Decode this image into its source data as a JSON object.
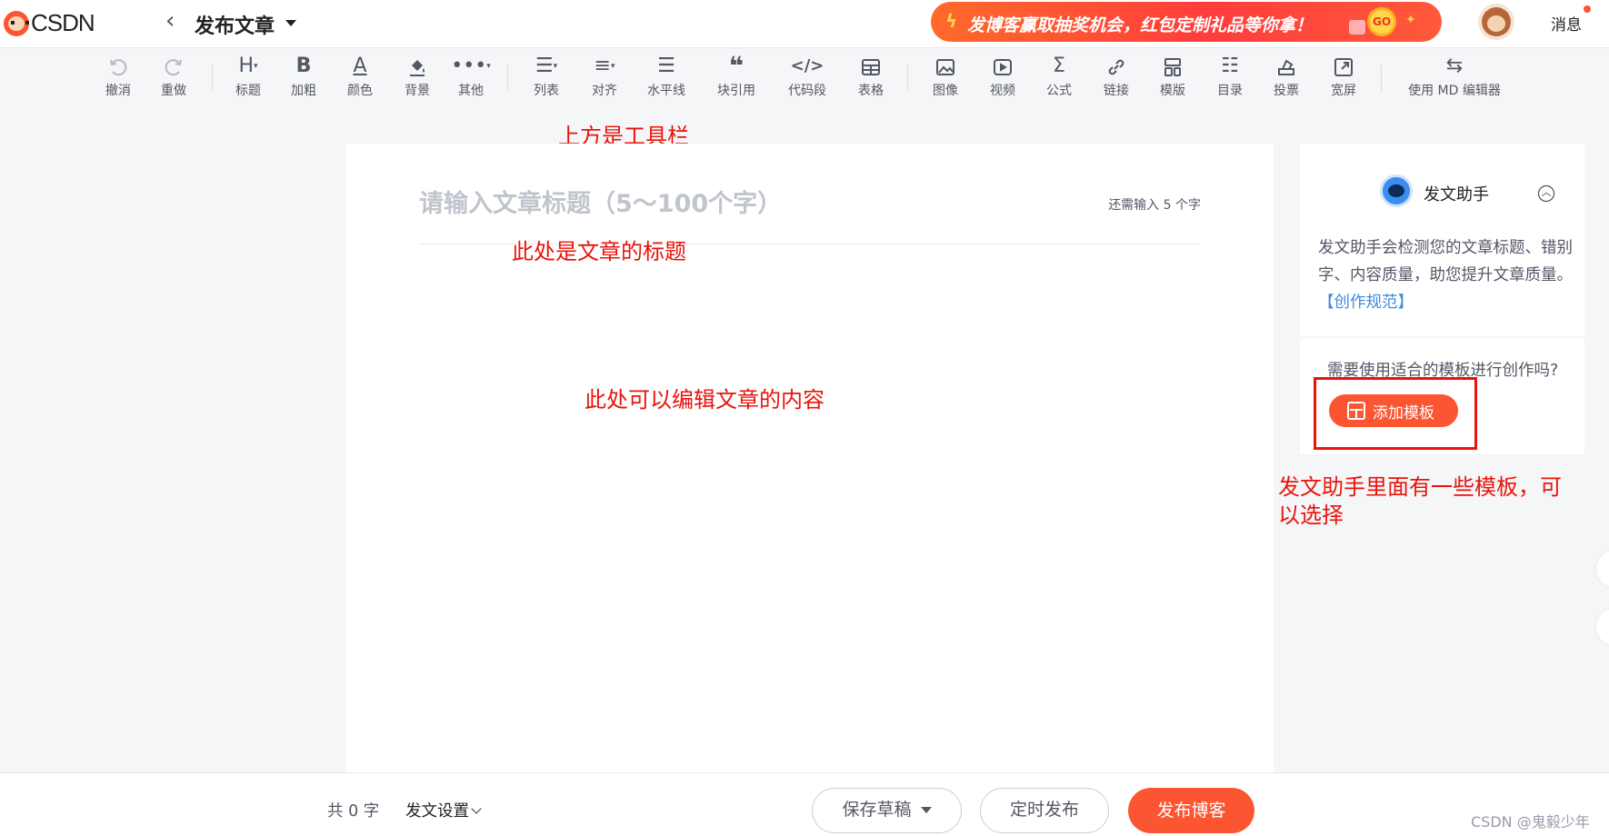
{
  "header": {
    "logo_text": "CSDN",
    "back_icon": "chevron-left-icon",
    "title": "发布文章",
    "banner_text": "发博客赢取抽奖机会，红包定制礼品等你拿！",
    "banner_go": "GO",
    "messages_label": "消息"
  },
  "toolbar": {
    "items": [
      {
        "icon": "undo-icon",
        "label": "撤消"
      },
      {
        "icon": "redo-icon",
        "label": "重做"
      },
      {
        "icon": "heading-icon",
        "label": "标题"
      },
      {
        "icon": "bold-icon",
        "label": "加粗"
      },
      {
        "icon": "font-color-icon",
        "label": "颜色"
      },
      {
        "icon": "background-icon",
        "label": "背景"
      },
      {
        "icon": "more-icon",
        "label": "其他"
      },
      {
        "icon": "list-icon",
        "label": "列表"
      },
      {
        "icon": "align-icon",
        "label": "对齐"
      },
      {
        "icon": "horizontal-rule-icon",
        "label": "水平线"
      },
      {
        "icon": "quote-icon",
        "label": "块引用"
      },
      {
        "icon": "code-icon",
        "label": "代码段"
      },
      {
        "icon": "table-icon",
        "label": "表格"
      },
      {
        "icon": "image-icon",
        "label": "图像"
      },
      {
        "icon": "video-icon",
        "label": "视频"
      },
      {
        "icon": "formula-icon",
        "label": "公式"
      },
      {
        "icon": "link-icon",
        "label": "链接"
      },
      {
        "icon": "template-icon",
        "label": "模版"
      },
      {
        "icon": "toc-icon",
        "label": "目录"
      },
      {
        "icon": "vote-icon",
        "label": "投票"
      },
      {
        "icon": "widescreen-icon",
        "label": "宽屏"
      },
      {
        "icon": "switch-icon",
        "label": "使用 MD 编辑器"
      }
    ]
  },
  "editor": {
    "title_placeholder": "请输入文章标题（5～100个字）",
    "title_value": "",
    "title_counter": "还需输入 5 个字"
  },
  "annotations": {
    "toolbar_note": "上方是工具栏",
    "title_note": "此处是文章的标题",
    "content_note": "此处可以编辑文章的内容",
    "helper_note_line1": "发文助手里面有一些模板，可",
    "helper_note_line2": "以选择"
  },
  "helper": {
    "title": "发文助手",
    "desc": "发文助手会检测您的文章标题、错别字、内容质量，助您提升文章质量。",
    "link": "【创作规范】",
    "template_question": "需要使用适合的模板进行创作吗?",
    "add_template": "添加模板"
  },
  "footer": {
    "word_count": "共 0 字",
    "publish_settings": "发文设置",
    "save_draft": "保存草稿",
    "schedule": "定时发布",
    "publish": "发布博客",
    "watermark": "CSDN @鬼毅少年"
  },
  "colors": {
    "accent": "#fc5531",
    "annotation": "#e8140c",
    "link": "#3d8bdc"
  }
}
